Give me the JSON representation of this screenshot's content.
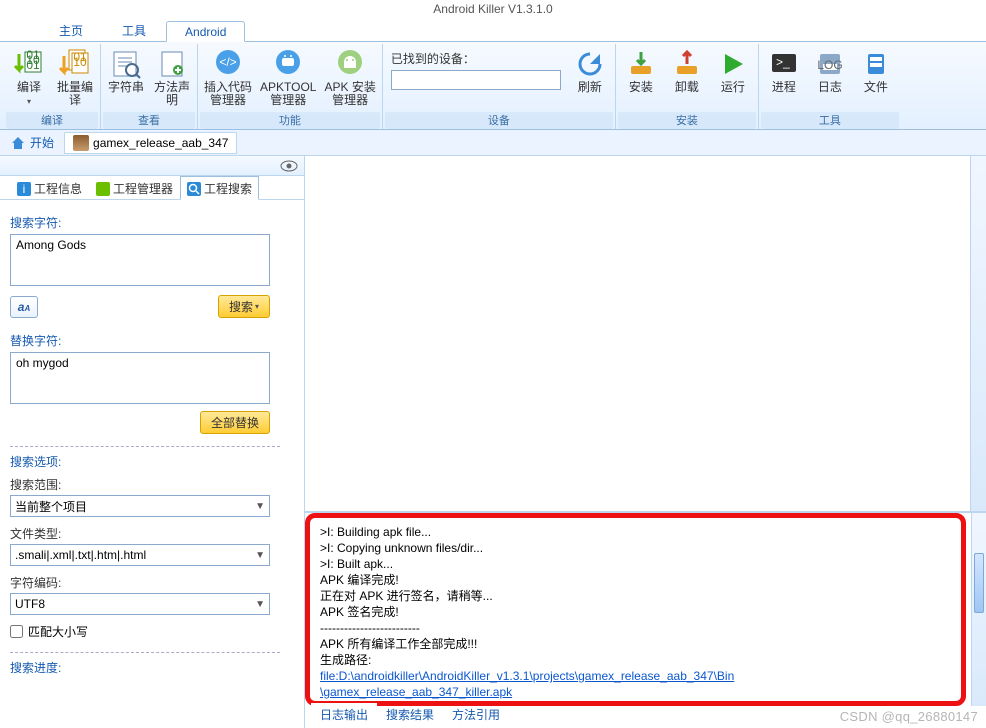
{
  "app": {
    "title": "Android Killer V1.3.1.0"
  },
  "menu": {
    "tabs": [
      "主页",
      "工具",
      "Android"
    ],
    "active": 2
  },
  "ribbon": {
    "groups": {
      "compile": {
        "title": "编译",
        "compile": "编译",
        "batch": "批量编\n译"
      },
      "view": {
        "title": "查看",
        "string": "字符串",
        "method": "方法声\n明"
      },
      "function": {
        "title": "功能",
        "inject": "插入代码\n管理器",
        "apktool": "APKTOOL\n管理器",
        "apkinstall": "APK 安装\n管理器"
      },
      "device": {
        "title": "设备",
        "found_label": "已找到的设备：",
        "value": "",
        "refresh": "刷新"
      },
      "install": {
        "title": "安装",
        "install": "安装",
        "uninstall": "卸载",
        "run": "运行"
      },
      "tools": {
        "title": "工具",
        "process": "进程",
        "log": "日志",
        "file": "文件"
      }
    }
  },
  "filetabs": {
    "home": "开始",
    "file": "gamex_release_aab_347"
  },
  "side": {
    "tabs": {
      "info": "工程信息",
      "manager": "工程管理器",
      "search": "工程搜索"
    },
    "search_section": {
      "search_label": "搜索字符:",
      "search_value": "Among Gods",
      "search_btn": "搜索",
      "replace_label": "替换字符:",
      "replace_value": "oh mygod",
      "replace_btn": "全部替换",
      "options_label": "搜索选项:",
      "scope_label": "搜索范围:",
      "scope_value": "当前整个项目",
      "filetype_label": "文件类型:",
      "filetype_value": ".smali|.xml|.txt|.htm|.html",
      "encoding_label": "字符编码:",
      "encoding_value": "UTF8",
      "matchcase_label": "匹配大小写",
      "progress_label": "搜索进度:"
    }
  },
  "log": {
    "lines": [
      ">I: Building apk file...",
      ">I: Copying unknown files/dir...",
      ">I: Built apk...",
      "APK 编译完成!",
      "正在对 APK 进行签名，请稍等...",
      "APK 签名完成!",
      "-------------------------",
      "APK 所有编译工作全部完成!!!",
      "生成路径:"
    ],
    "link_lines": [
      "file:D:\\androidkiller\\AndroidKiller_v1.3.1\\projects\\gamex_release_aab_347\\Bin",
      "\\gamex_release_aab_347_killer.apk"
    ],
    "tabs": {
      "output": "日志输出",
      "results": "搜索结果",
      "methodref": "方法引用"
    }
  },
  "watermark": "CSDN @qq_26880147"
}
